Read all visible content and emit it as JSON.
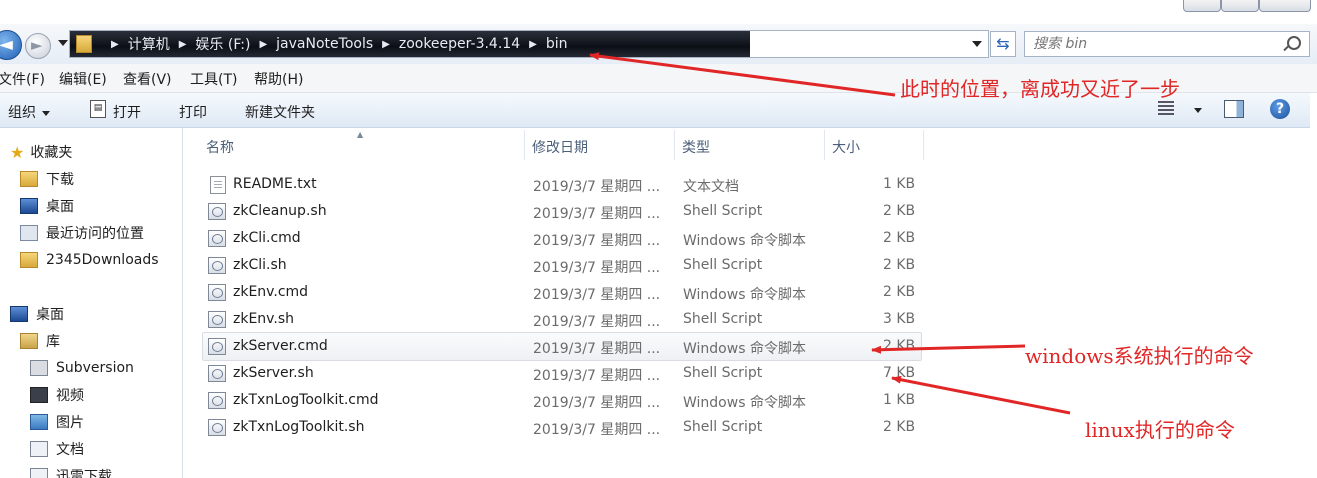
{
  "address_bar": {
    "crumbs": [
      "计算机",
      "娱乐 (F:)",
      "javaNoteTools",
      "zookeeper-3.4.14",
      "bin"
    ],
    "search_placeholder": "搜索 bin"
  },
  "menu": [
    "文件(F)",
    "编辑(E)",
    "查看(V)",
    "工具(T)",
    "帮助(H)"
  ],
  "toolbar": {
    "organize": "组织",
    "open": "打开",
    "print": "打印",
    "new_folder": "新建文件夹"
  },
  "nav": {
    "favorites": "收藏夹",
    "items": [
      "下载",
      "桌面",
      "最近访问的位置",
      "2345Downloads"
    ],
    "desktop": "桌面",
    "library": "库",
    "lib_items": [
      "Subversion",
      "视频",
      "图片",
      "文档",
      "迅雷下载"
    ]
  },
  "columns": {
    "name": "名称",
    "date": "修改日期",
    "type": "类型",
    "size": "大小"
  },
  "files": [
    {
      "name": "README.txt",
      "date": "2019/3/7 星期四 ...",
      "type": "文本文档",
      "size": "1 KB"
    },
    {
      "name": "zkCleanup.sh",
      "date": "2019/3/7 星期四 ...",
      "type": "Shell Script",
      "size": "2 KB"
    },
    {
      "name": "zkCli.cmd",
      "date": "2019/3/7 星期四 ...",
      "type": "Windows 命令脚本",
      "size": "2 KB"
    },
    {
      "name": "zkCli.sh",
      "date": "2019/3/7 星期四 ...",
      "type": "Shell Script",
      "size": "2 KB"
    },
    {
      "name": "zkEnv.cmd",
      "date": "2019/3/7 星期四 ...",
      "type": "Windows 命令脚本",
      "size": "2 KB"
    },
    {
      "name": "zkEnv.sh",
      "date": "2019/3/7 星期四 ...",
      "type": "Shell Script",
      "size": "3 KB"
    },
    {
      "name": "zkServer.cmd",
      "date": "2019/3/7 星期四 ...",
      "type": "Windows 命令脚本",
      "size": "2 KB"
    },
    {
      "name": "zkServer.sh",
      "date": "2019/3/7 星期四 ...",
      "type": "Shell Script",
      "size": "7 KB"
    },
    {
      "name": "zkTxnLogToolkit.cmd",
      "date": "2019/3/7 星期四 ...",
      "type": "Windows 命令脚本",
      "size": "1 KB"
    },
    {
      "name": "zkTxnLogToolkit.sh",
      "date": "2019/3/7 星期四 ...",
      "type": "Shell Script",
      "size": "2 KB"
    }
  ],
  "annotations": {
    "position": "此时的位置，离成功又近了一步",
    "windows": "windows系统执行的命令",
    "linux": "linux执行的命令"
  },
  "colors": {
    "annotation": "#e02626",
    "accent": "#1f5fb4"
  }
}
